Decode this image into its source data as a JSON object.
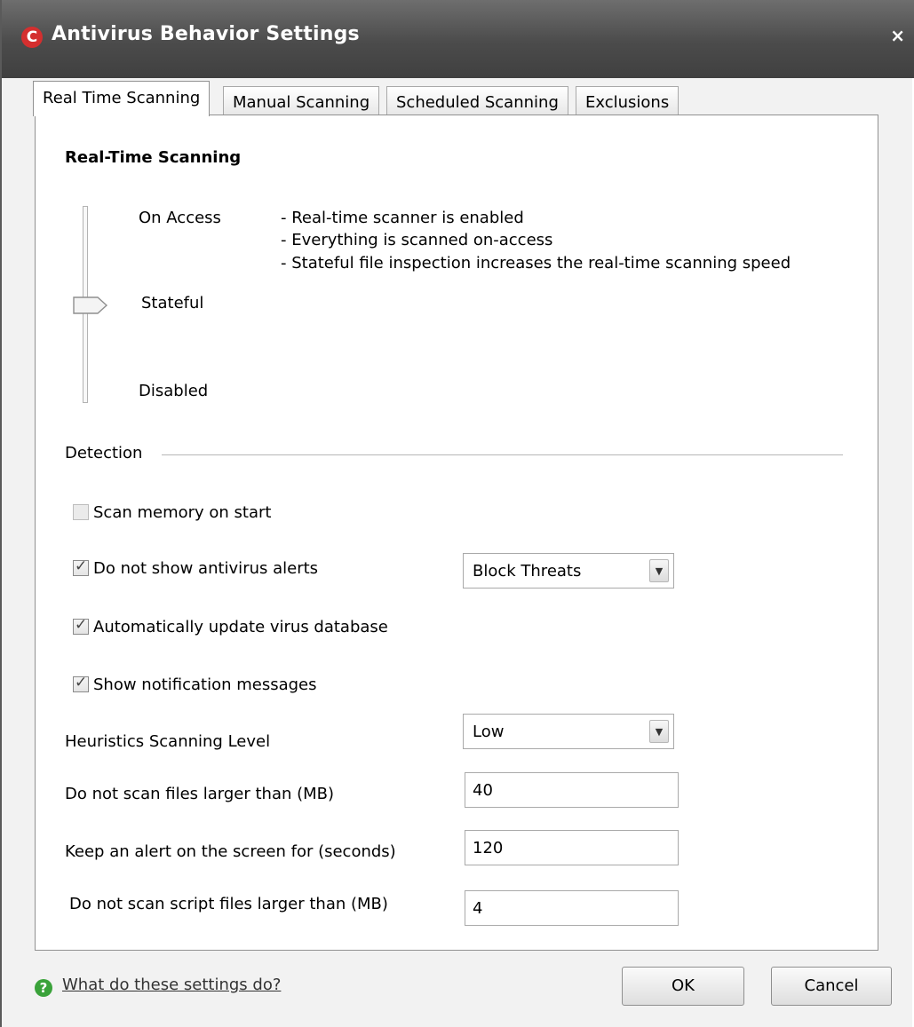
{
  "window": {
    "title": "Antivirus Behavior Settings",
    "close_symbol": "×",
    "logo_letter": "C"
  },
  "tabs": [
    {
      "label": "Real Time Scanning",
      "active": true
    },
    {
      "label": "Manual Scanning",
      "active": false
    },
    {
      "label": "Scheduled Scanning",
      "active": false
    },
    {
      "label": "Exclusions",
      "active": false
    }
  ],
  "realtime": {
    "heading": "Real-Time Scanning",
    "levels": [
      "On Access",
      "Stateful",
      "Disabled"
    ],
    "selected_level": "Stateful",
    "description": [
      "- Real-time scanner is enabled",
      "- Everything is scanned on-access",
      "- Stateful file inspection increases the real-time scanning speed"
    ]
  },
  "detection": {
    "label": "Detection",
    "scan_memory": {
      "label": "Scan memory on start",
      "checked": false,
      "enabled": false
    },
    "no_alerts": {
      "label": "Do not show antivirus alerts",
      "checked": true,
      "dropdown_value": "Block Threats"
    },
    "auto_update": {
      "label": "Automatically update virus database",
      "checked": true
    },
    "notifications": {
      "label": "Show notification messages",
      "checked": true
    },
    "heuristics": {
      "label": "Heuristics Scanning Level",
      "value": "Low"
    },
    "max_file_size": {
      "label": "Do not scan files larger than (MB)",
      "value": "40"
    },
    "alert_duration": {
      "label": "Keep an alert on the screen for (seconds)",
      "value": "120"
    },
    "max_script_size": {
      "label": "Do not scan script files larger than (MB)",
      "value": "4"
    }
  },
  "footer": {
    "help_label": "What do these settings do?",
    "ok_label": "OK",
    "cancel_label": "Cancel"
  },
  "icons": {
    "app_logo": "comodo-logo-icon",
    "help": "help-icon",
    "dropdown": "chevron-down-icon",
    "close": "close-icon"
  },
  "colors": {
    "titlebar": "#555555",
    "logo": "#d42f2f",
    "help_icon": "#3aa23a"
  }
}
